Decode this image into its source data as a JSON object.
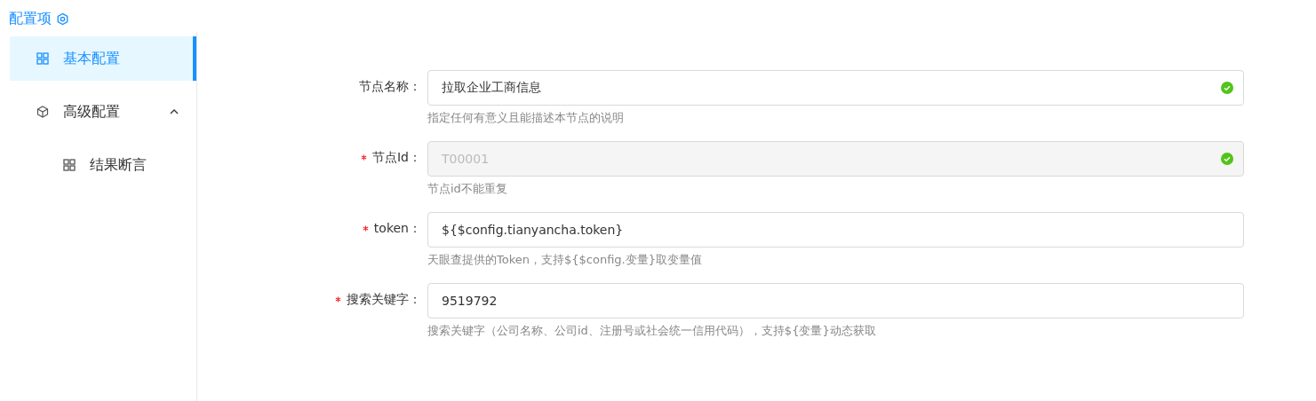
{
  "panel_title": "配置项",
  "menu": [
    {
      "label": "基本配置",
      "selected": true
    },
    {
      "label": "高级配置",
      "selected": false,
      "expanded": true,
      "children": [
        {
          "label": "结果断言",
          "selected": false
        }
      ]
    }
  ],
  "fields": [
    {
      "label": "节点名称：",
      "required": false,
      "value": "拉取企业工商信息",
      "disabled": false,
      "valid": true,
      "help": "指定任何有意义且能描述本节点的说明"
    },
    {
      "label": "节点Id：",
      "required": true,
      "value": "T00001",
      "disabled": true,
      "valid": true,
      "help": "节点id不能重复"
    },
    {
      "label": "token：",
      "required": true,
      "value": "${$config.tianyancha.token}",
      "disabled": false,
      "valid": false,
      "help": "天眼查提供的Token，支持${$config.变量}取变量值"
    },
    {
      "label": "搜索关键字：",
      "required": true,
      "value": "9519792",
      "disabled": false,
      "valid": false,
      "help": "搜索关键字（公司名称、公司id、注册号或社会统一信用代码），支持${变量}动态获取"
    }
  ]
}
